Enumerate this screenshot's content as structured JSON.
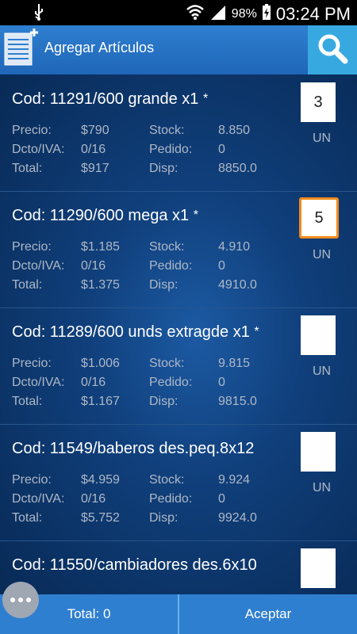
{
  "status": {
    "battery": "98%",
    "time": "03:24 PM"
  },
  "app_bar": {
    "title": "Agregar Artículos"
  },
  "labels": {
    "precio": "Precio:",
    "dcto": "Dcto/IVA:",
    "total": "Total:",
    "stock": "Stock:",
    "pedido": "Pedido:",
    "disp": "Disp:"
  },
  "items": [
    {
      "code": "Cod: 11291/600 grande x1",
      "star": "*",
      "precio": "$790",
      "dcto": "0/16",
      "total": "$917",
      "stock": "8.850",
      "pedido": "0",
      "disp": "8850.0",
      "qty": "3",
      "unit": "UN"
    },
    {
      "code": "Cod: 11290/600 mega x1",
      "star": "*",
      "precio": "$1.185",
      "dcto": "0/16",
      "total": "$1.375",
      "stock": "4.910",
      "pedido": "0",
      "disp": "4910.0",
      "qty": "5",
      "unit": "UN"
    },
    {
      "code": "Cod: 11289/600 unds extragde x1",
      "star": "*",
      "precio": "$1.006",
      "dcto": "0/16",
      "total": "$1.167",
      "stock": "9.815",
      "pedido": "0",
      "disp": "9815.0",
      "qty": "",
      "unit": "UN"
    },
    {
      "code": "Cod: 11549/baberos des.peq.8x12",
      "star": "",
      "precio": "$4.959",
      "dcto": "0/16",
      "total": "$5.752",
      "stock": "9.924",
      "pedido": "0",
      "disp": "9924.0",
      "qty": "",
      "unit": "UN"
    },
    {
      "code": "Cod: 11550/cambiadores des.6x10",
      "star": "",
      "qty": ""
    }
  ],
  "footer": {
    "total": "Total: 0",
    "accept": "Aceptar"
  },
  "icons": {
    "usb": "usb-icon",
    "wifi": "wifi-icon",
    "signal": "signal-icon",
    "battery": "battery-charging-icon",
    "app": "document-add-icon",
    "search": "search-icon",
    "more": "more-dots-icon"
  },
  "colors": {
    "app_bar": "#2f7fd0",
    "search_btn": "#38a9e0",
    "focus": "#f08a1d",
    "list_bg": "#0a2e5c"
  }
}
